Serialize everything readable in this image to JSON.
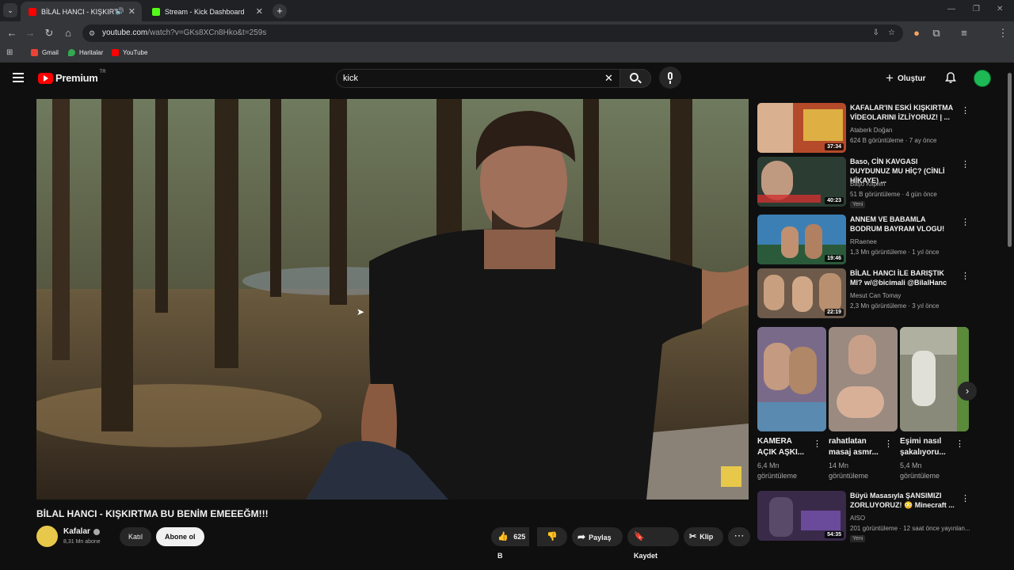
{
  "browser": {
    "tabs": [
      {
        "title": "BİLAL HANCI - KIŞKIRTMA BU",
        "active": true,
        "favicon_color": "#ff0000"
      },
      {
        "title": "Stream - Kick Dashboard",
        "active": false,
        "favicon_color": "#53fc18"
      }
    ],
    "url": {
      "host": "youtube.com",
      "path": "/watch?v=GKs8XCn8Hko&t=259s"
    },
    "bookmarks": [
      "Gmail",
      "Haritalar",
      "YouTube"
    ]
  },
  "youtube": {
    "logo": "Premium",
    "region": "TR",
    "search_query": "kick",
    "create_label": "Oluştur"
  },
  "video": {
    "title": "BİLAL HANCI - KIŞKIRTMA BU BENİM EMEEEĞM!!!",
    "channel": "Kafalar",
    "subscribers": "8,31 Mn abone",
    "join_label": "Katıl",
    "subscribe_label": "Abone ol",
    "likes": "625 B",
    "share_label": "Paylaş",
    "save_label": "Kaydet",
    "clip_label": "Klip"
  },
  "recommendations": [
    {
      "title": "KAFALAR'IN ESKİ KIŞKIRTMA VİDEOLARINI İZLİYORUZ! | ...",
      "channel": "Ataberk Doğan",
      "meta": "624 B görüntüleme · 7 ay önce",
      "duration": "37:34",
      "new": "",
      "thumb_color": "#b44a2a"
    },
    {
      "title": "Baso, CİN KAVGASI DUYDUNUZ MU HİÇ? (CİNLİ HİKAYE) ...",
      "channel": "Başo Klipleri",
      "meta": "51 B görüntüleme · 4 gün önce",
      "duration": "40:23",
      "new": "Yeni",
      "thumb_color": "#2b3d33"
    },
    {
      "title": "ANNEM VE BABAMLA BODRUM BAYRAM VLOGU!",
      "channel": "RRaenee",
      "meta": "1,3 Mn görüntüleme · 1 yıl önce",
      "duration": "19:46",
      "new": "",
      "thumb_color": "#3c7fb4"
    },
    {
      "title": "BİLAL HANCI İLE BARIŞTIK MI? w/@bicimali @BilalHanc",
      "channel": "Mesut Can Tomay",
      "meta": "2,3 Mn görüntüleme · 3 yıl önce",
      "duration": "22:19",
      "new": "",
      "thumb_color": "#6d5a4a"
    },
    {
      "title": "Büyü Masasıyla ŞANSIMIZI ZORLUYORUZ! 😳 Minecraft ...",
      "channel": "AISO",
      "meta": "201 görüntüleme · 12 saat önce yayınlan...",
      "duration": "54:35",
      "new": "Yeni",
      "thumb_color": "#3a2a4a"
    }
  ],
  "shorts": [
    {
      "title": "KAMERA AÇIK AŞKI...",
      "views": "6,4 Mn görüntüleme",
      "color": "#7a6a8a"
    },
    {
      "title": "rahatlatan masaj asmr...",
      "views": "14 Mn görüntüleme",
      "color": "#9a8a80"
    },
    {
      "title": "Eşimi nasıl şakalıyoru...",
      "views": "5,4 Mn görüntüleme",
      "color": "#8a8a7a"
    }
  ]
}
